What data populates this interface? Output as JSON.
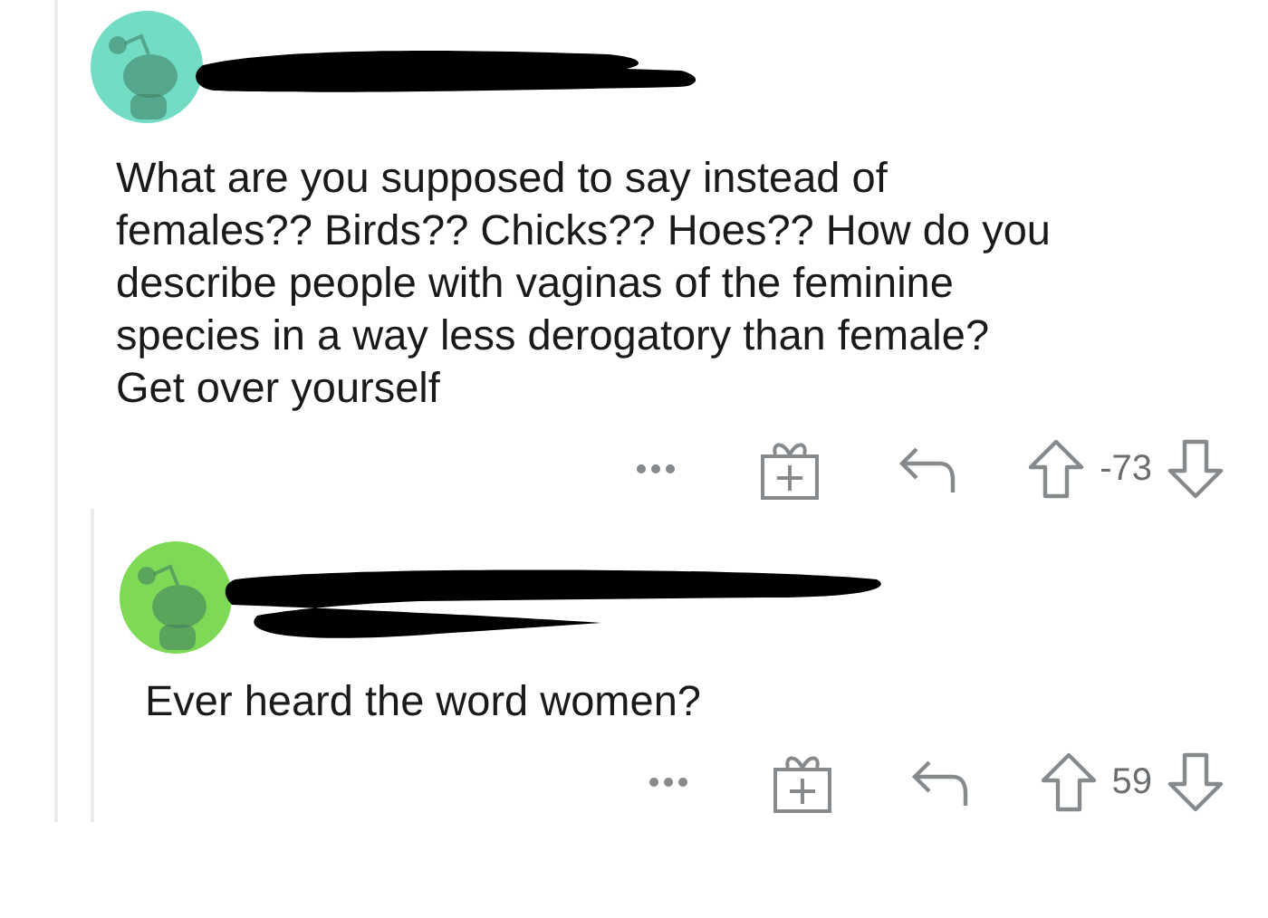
{
  "comments": [
    {
      "color": "#72dcc4",
      "body_lines": [
        "What are you supposed to say instead of",
        "females?? Birds?? Chicks?? Hoes?? How do you",
        "describe people with vaginas of the feminine",
        "species in a way less derogatory than female?",
        "Get over yourself"
      ],
      "score": "-73",
      "children": [
        {
          "color": "#7ed957",
          "body_lines": [
            "Ever heard the word women?"
          ],
          "score": "59"
        }
      ]
    }
  ]
}
